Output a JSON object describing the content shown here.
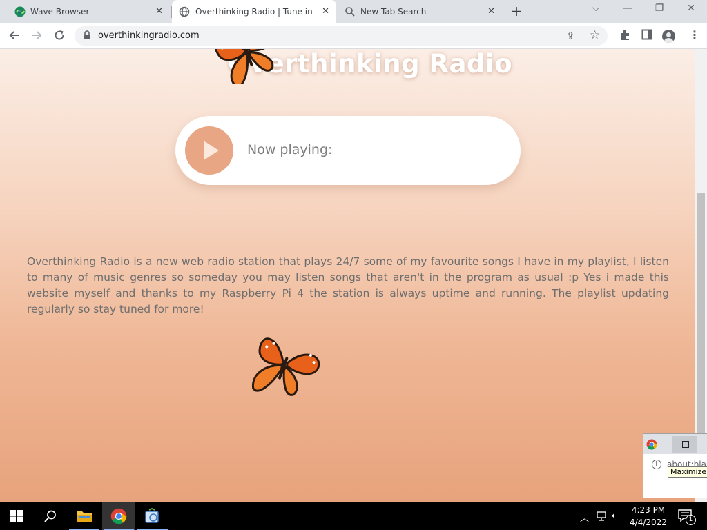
{
  "tabs": [
    {
      "title": "Wave Browser",
      "icon": "wave-browser-icon"
    },
    {
      "title": "Overthinking Radio | Tune in the",
      "icon": "globe-icon",
      "active": true
    },
    {
      "title": "New Tab Search",
      "icon": "search-icon"
    }
  ],
  "toolbar": {
    "url": "overthinkingradio.com"
  },
  "page": {
    "site_title": "Overthinking Radio",
    "now_playing_label": "Now playing:",
    "description": "Overthinking Radio is a new web radio station that plays 24/7 some of my favourite songs I have in my playlist, I listen to many of music genres so someday you may listen songs that aren't in the program as usual :p Yes i made this website myself and thanks to my Raspberry Pi 4 the station is always uptime and running. The playlist updating regularly so stay tuned for more!"
  },
  "popup": {
    "url": "about:bla",
    "tooltip": "Maximize"
  },
  "taskbar": {
    "time": "4:23 PM",
    "date": "4/4/2022",
    "notification_count": "1"
  },
  "colors": {
    "accent_play": "#e8a684",
    "page_top": "#fbeee6",
    "page_bottom": "#e7a37c"
  }
}
